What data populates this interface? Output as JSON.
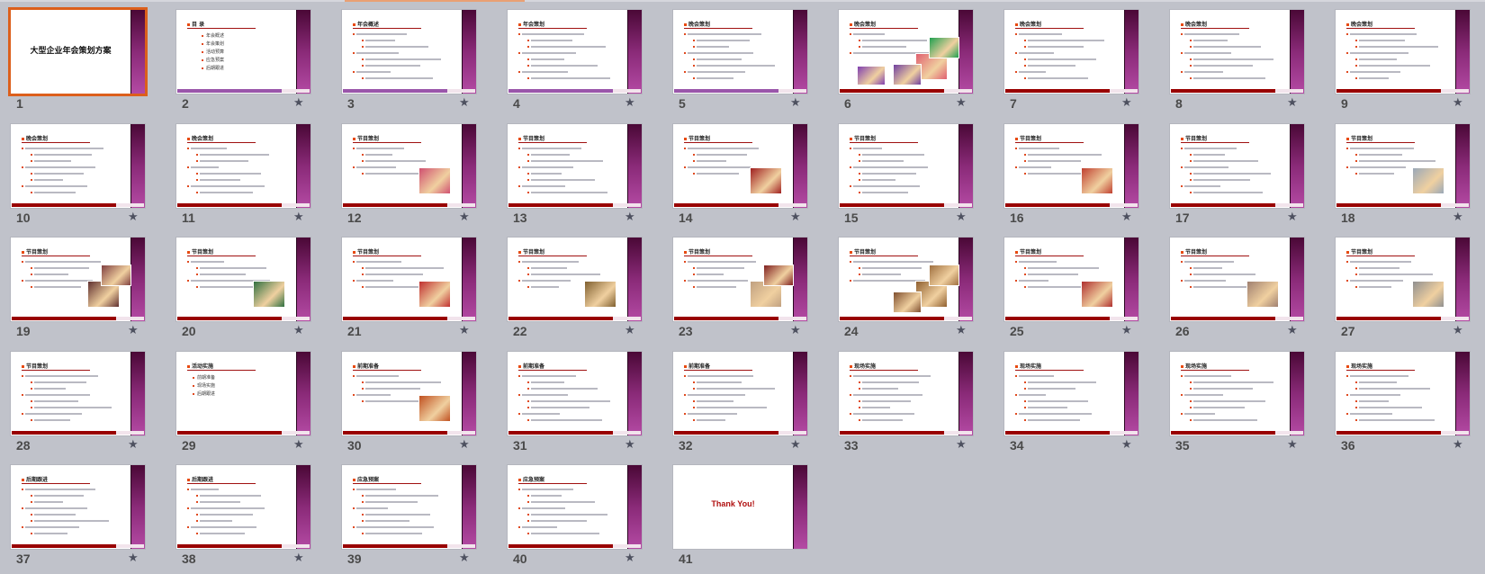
{
  "view": "slide-sorter",
  "colors": {
    "background": "#c0c2ca",
    "selection": "#dc5f1c",
    "accent_red": "#990000",
    "accent_purple": "#9a56aa",
    "progress": "#e9a074"
  },
  "icons": {
    "transition": "star-icon"
  },
  "selected_slide": 1,
  "slides": [
    {
      "n": "1",
      "big_title": "大型企业年会策划方案",
      "bar": "none"
    },
    {
      "n": "2",
      "title": "目 录",
      "items": [
        "年会概述",
        "年会策划",
        "活动预算",
        "应急预案",
        "后期跟进"
      ],
      "bar": "purple"
    },
    {
      "n": "3",
      "title": "年会概述",
      "bar": "purple"
    },
    {
      "n": "4",
      "title": "年会策划",
      "bar": "purple"
    },
    {
      "n": "5",
      "title": "晚会策划",
      "bar": "purple"
    },
    {
      "n": "6",
      "title": "晚会策划",
      "photos": [
        {
          "color": "#e06070"
        },
        {
          "color": "#20a050"
        },
        {
          "color": "#7040a0"
        },
        {
          "color": "#8040b0"
        }
      ]
    },
    {
      "n": "7",
      "title": "晚会策划"
    },
    {
      "n": "8",
      "title": "晚会策划"
    },
    {
      "n": "9",
      "title": "晚会策划"
    },
    {
      "n": "10",
      "title": "晚会策划"
    },
    {
      "n": "11",
      "title": "晚会策划"
    },
    {
      "n": "12",
      "title": "节目策划",
      "photos": [
        {
          "color": "#d05070"
        }
      ]
    },
    {
      "n": "13",
      "title": "节目策划"
    },
    {
      "n": "14",
      "title": "节目策划",
      "photos": [
        {
          "color": "#a02020"
        }
      ]
    },
    {
      "n": "15",
      "title": "节目策划"
    },
    {
      "n": "16",
      "title": "节目策划",
      "photos": [
        {
          "color": "#c04030"
        }
      ]
    },
    {
      "n": "17",
      "title": "节目策划"
    },
    {
      "n": "18",
      "title": "节目策划",
      "photos": [
        {
          "color": "#9aa8b8"
        }
      ]
    },
    {
      "n": "19",
      "title": "节目策划",
      "photos": [
        {
          "color": "#603030"
        },
        {
          "color": "#804040"
        }
      ]
    },
    {
      "n": "20",
      "title": "节目策划",
      "photos": [
        {
          "color": "#307040"
        }
      ]
    },
    {
      "n": "21",
      "title": "节目策划",
      "photos": [
        {
          "color": "#c03030"
        }
      ]
    },
    {
      "n": "22",
      "title": "节目策划",
      "photos": [
        {
          "color": "#806030"
        }
      ]
    },
    {
      "n": "23",
      "title": "节目策划",
      "photos": [
        {
          "color": "#c0a080"
        },
        {
          "color": "#802020"
        }
      ]
    },
    {
      "n": "24",
      "title": "节目策划",
      "photos": [
        {
          "color": "#906030"
        },
        {
          "color": "#a07040"
        },
        {
          "color": "#805030"
        }
      ]
    },
    {
      "n": "25",
      "title": "节目策划",
      "photos": [
        {
          "color": "#b03030"
        }
      ]
    },
    {
      "n": "26",
      "title": "节目策划",
      "photos": [
        {
          "color": "#a08070"
        }
      ]
    },
    {
      "n": "27",
      "title": "节目策划",
      "photos": [
        {
          "color": "#909090"
        }
      ]
    },
    {
      "n": "28",
      "title": "节目策划"
    },
    {
      "n": "29",
      "title": "活动实施",
      "items": [
        "前期准备",
        "现场实施",
        "后期跟进"
      ]
    },
    {
      "n": "30",
      "title": "前期准备",
      "photos": [
        {
          "color": "#c05020"
        }
      ]
    },
    {
      "n": "31",
      "title": "前期准备"
    },
    {
      "n": "32",
      "title": "前期准备"
    },
    {
      "n": "33",
      "title": "现场实施"
    },
    {
      "n": "34",
      "title": "现场实施"
    },
    {
      "n": "35",
      "title": "现场实施"
    },
    {
      "n": "36",
      "title": "现场实施"
    },
    {
      "n": "37",
      "title": "后期跟进"
    },
    {
      "n": "38",
      "title": "后期跟进"
    },
    {
      "n": "39",
      "title": "应急预案"
    },
    {
      "n": "40",
      "title": "应急预案"
    },
    {
      "n": "41",
      "thanks": "Thank You!",
      "bar": "none"
    }
  ]
}
